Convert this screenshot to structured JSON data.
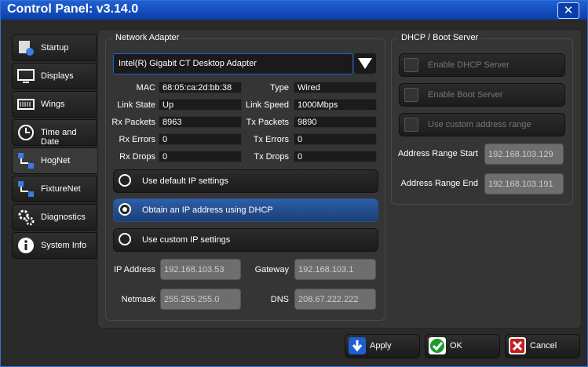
{
  "window": {
    "title": "Control Panel: v3.14.0"
  },
  "sidebar": {
    "tabs": [
      {
        "label": "Startup",
        "icon": "startup-icon"
      },
      {
        "label": "Displays",
        "icon": "monitor-icon"
      },
      {
        "label": "Wings",
        "icon": "wing-icon"
      },
      {
        "label": "Time and Date",
        "icon": "clock-icon"
      },
      {
        "label": "HogNet",
        "icon": "network-icon",
        "active": true
      },
      {
        "label": "FixtureNet",
        "icon": "network-icon"
      },
      {
        "label": "Diagnostics",
        "icon": "gear-icon"
      },
      {
        "label": "System Info",
        "icon": "info-icon"
      }
    ]
  },
  "network_adapter": {
    "group_title": "Network Adapter",
    "selected_adapter": "Intel(R) Gigabit CT Desktop Adapter",
    "mac_label": "MAC",
    "mac": "68:05:ca:2d:bb:38",
    "type_label": "Type",
    "type": "Wired",
    "link_state_label": "Link State",
    "link_state": "Up",
    "link_speed_label": "Link Speed",
    "link_speed": "1000Mbps",
    "rx_packets_label": "Rx Packets",
    "rx_packets": "8963",
    "tx_packets_label": "Tx Packets",
    "tx_packets": "9890",
    "rx_errors_label": "Rx Errors",
    "rx_errors": "0",
    "tx_errors_label": "Tx Errors",
    "tx_errors": "0",
    "rx_drops_label": "Rx Drops",
    "rx_drops": "0",
    "tx_drops_label": "Tx Drops",
    "tx_drops": "0",
    "ip_options": [
      {
        "label": "Use default IP settings",
        "selected": false
      },
      {
        "label": "Obtain an IP address using DHCP",
        "selected": true
      },
      {
        "label": "Use custom IP settings",
        "selected": false
      }
    ],
    "ip_address_label": "IP Address",
    "ip_address": "192.168.103.53",
    "gateway_label": "Gateway",
    "gateway": "192.168.103.1",
    "netmask_label": "Netmask",
    "netmask": "255.255.255.0",
    "dns_label": "DNS",
    "dns": "208.67.222.222"
  },
  "dhcp": {
    "group_title": "DHCP / Boot Server",
    "enable_dhcp_label": "Enable DHCP Server",
    "enable_boot_label": "Enable Boot Server",
    "custom_range_label": "Use custom address range",
    "range_start_label": "Address Range Start",
    "range_start": "192.168.103.129",
    "range_end_label": "Address Range End",
    "range_end": "192.168.103.191"
  },
  "buttons": {
    "apply": "Apply",
    "ok": "OK",
    "cancel": "Cancel"
  },
  "colors": {
    "titlebar": "#1f61d6",
    "selected_option": "#2d5fa8",
    "ok_green": "#1d9a2a",
    "cancel_red": "#c41e1e",
    "apply_blue": "#1f5fd0"
  }
}
